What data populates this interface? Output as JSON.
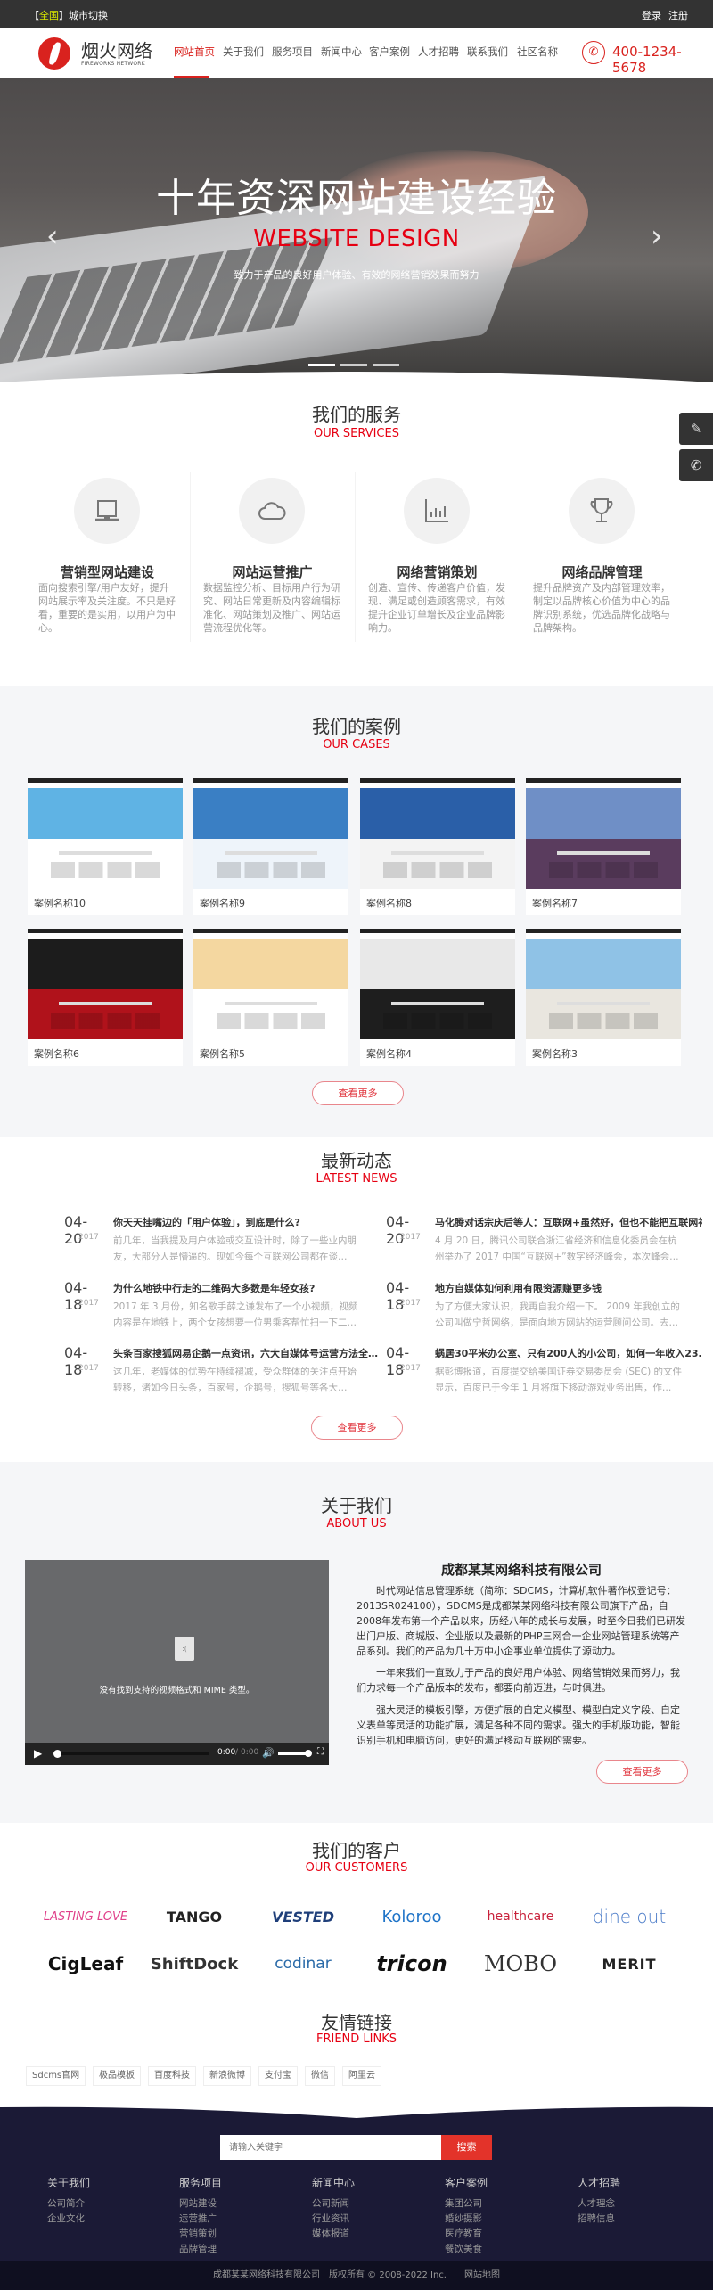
{
  "topbar": {
    "city_bracket_open": "【",
    "city_highlight": "全国",
    "city_bracket_close": "】",
    "city_switch": "城市切换",
    "login": "登录",
    "register": "注册"
  },
  "header": {
    "logo_name": "烟火网络",
    "logo_en": "FIREWORKS NETWORK",
    "phone": "400-1234-5678",
    "nav": [
      "网站首页",
      "关于我们",
      "服务项目",
      "新闻中心",
      "客户案例",
      "人才招聘",
      "联系我们",
      "社区名称"
    ],
    "active_index": 0
  },
  "hero": {
    "title": "十年资深网站建设经验",
    "subtitle_en": "WEBSITE DESIGN",
    "desc": "致力于产品的良好用户体验、有效的网络营销效果而努力",
    "slides": 3,
    "active_slide": 0
  },
  "services": {
    "title": "我们的服务",
    "title_en": "OUR SERVICES",
    "items": [
      {
        "icon": "laptop-icon",
        "title": "营销型网站建设",
        "desc": "面向搜索引擎/用户友好，提升网站展示率及关注度。不只是好看，重要的是实用，以用户为中心。"
      },
      {
        "icon": "cloud-icon",
        "title": "网站运营推广",
        "desc": "数据监控分析、目标用户行为研究、网站日常更新及内容编辑标准化、网站策划及推广、网站运营流程优化等。"
      },
      {
        "icon": "bar-chart-icon",
        "title": "网络营销策划",
        "desc": "创造、宣传、传递客户价值，发现、满足或创造顾客需求，有效提升企业订单增长及企业品牌影响力。"
      },
      {
        "icon": "trophy-icon",
        "title": "网络品牌管理",
        "desc": "提升品牌资产及内部管理效率，制定以品牌核心价值为中心的品牌识别系统，优选品牌化战略与品牌架构。"
      }
    ]
  },
  "cases": {
    "title": "我们的案例",
    "title_en": "OUR CASES",
    "more": "查看更多",
    "items": [
      {
        "name": "案例名称10",
        "colors": [
          "#5fb3e4",
          "#ffffff"
        ]
      },
      {
        "name": "案例名称9",
        "colors": [
          "#3a7fc4",
          "#eef4fa"
        ]
      },
      {
        "name": "案例名称8",
        "colors": [
          "#2a5fa8",
          "#f3f3f3"
        ]
      },
      {
        "name": "案例名称7",
        "colors": [
          "#6f8fc6",
          "#5a3c5e"
        ]
      },
      {
        "name": "案例名称6",
        "colors": [
          "#1c1c1c",
          "#b0121b"
        ]
      },
      {
        "name": "案例名称5",
        "colors": [
          "#f4d7a0",
          "#ffffff"
        ]
      },
      {
        "name": "案例名称4",
        "colors": [
          "#e8e8e8",
          "#1e1e1e"
        ]
      },
      {
        "name": "案例名称3",
        "colors": [
          "#8fc2e6",
          "#e9e6df"
        ]
      }
    ]
  },
  "news": {
    "title": "最新动态",
    "title_en": "LATEST NEWS",
    "more": "查看更多",
    "items": [
      {
        "date": "04-20",
        "year": "2017",
        "title": "你天天挂嘴边的「用户体验」，到底是什么?",
        "excerpt": "前几年，当我提及用户体验或交互设计时，除了一些业内朋友，大部分人是懵逼的。现如今每个互联网公司都在谈…"
      },
      {
        "date": "04-20",
        "year": "2017",
        "title": "马化腾对话宗庆后等人：互联网+虽然好，但也不能把互联网神",
        "excerpt": "4 月 20 日，腾讯公司联合浙江省经济和信息化委员会在杭州举办了 2017 中国“互联网+”数字经济峰会，本次峰会…"
      },
      {
        "date": "04-18",
        "year": "2017",
        "title": "为什么地铁中行走的二维码大多数是年轻女孩?",
        "excerpt": "2017 年 3 月份，知名歌手薛之谦发布了一个小视频，视频内容是在地铁上，两个女孩想要一位男乘客帮忙扫一下二…"
      },
      {
        "date": "04-18",
        "year": "2017",
        "title": "地方自媒体如何利用有限资源赚更多钱",
        "excerpt": "为了方便大家认识，我再自我介绍一下。 2009 年我创立的公司叫做宁哲网络，是面向地方网站的运营顾问公司。去…"
      },
      {
        "date": "04-18",
        "year": "2017",
        "title": "头条百家搜狐网易企鹅一点资讯，六大自媒体号运营方法全…",
        "excerpt": "这几年，老媒体的优势在持续褪减，受众群体的关注点开始转移，诸如今日头条，百家号，企鹅号，搜狐号等各大…"
      },
      {
        "date": "04-18",
        "year": "2017",
        "title": "蜗居30平米办公室、只有200人的小公司，如何一年收入23…",
        "excerpt": "据彭博报道，百度提交给美国证券交易委员会 (SEC) 的文件显示，百度已于今年 1 月将旗下移动游戏业务出售，作…"
      }
    ]
  },
  "about": {
    "title": "关于我们",
    "title_en": "ABOUT US",
    "company": "成都某某网络科技有限公司",
    "more": "查看更多",
    "video_error": "没有找到支持的视频格式和 MIME 类型。",
    "video_time": "0:00",
    "video_duration": "0:00",
    "paragraphs": [
      "时代网站信息管理系统（简称：SDCMS，计算机软件著作权登记号：2013SR024100），SDCMS是成都某某网络科技有限公司旗下产品，自2008年发布第一个产品以来，历经八年的成长与发展，时至今日我们已研发出门户版、商城版、企业版以及最新的PHP三网合一企业网站管理系统等产品系列。我们的产品为几十万中小企事业单位提供了源动力。",
      "十年来我们一直致力于产品的良好用户体验、网络营销效果而努力，我们力求每一个产品版本的发布，都要向前迈进，与时俱进。",
      "强大灵活的模板引擎，方便扩展的自定义模型、模型自定义字段、自定义表单等灵活的功能扩展，满足各种不同的需求。强大的手机版功能，智能识别手机和电脑访问，更好的满足移动互联网的需要。"
    ]
  },
  "customers": {
    "title": "我们的客户",
    "title_en": "OUR CUSTOMERS",
    "logos": [
      {
        "name": "LASTING LOVE",
        "color": "#e0408a"
      },
      {
        "name": "TANGO",
        "color": "#222222"
      },
      {
        "name": "VESTED",
        "color": "#1f3f7a"
      },
      {
        "name": "Koloroo",
        "color": "#1f74c8"
      },
      {
        "name": "healthcare",
        "color": "#c8203a"
      },
      {
        "name": "dine out",
        "color": "#4a7bc8"
      },
      {
        "name": "CigLeaf",
        "color": "#111111"
      },
      {
        "name": "ShiftDock",
        "color": "#333333"
      },
      {
        "name": "codinar",
        "color": "#2a6aa8"
      },
      {
        "name": "tricon",
        "color": "#111111"
      },
      {
        "name": "MOBO",
        "color": "#333333"
      },
      {
        "name": "MERIT",
        "color": "#222222"
      }
    ]
  },
  "friend_links": {
    "title": "友情链接",
    "title_en": "FRIEND LINKS",
    "items": [
      "Sdcms官网",
      "极品模板",
      "百度科技",
      "新浪微博",
      "支付宝",
      "微信",
      "阿里云"
    ]
  },
  "footer": {
    "search_placeholder": "请输入关键字",
    "search_button": "搜索",
    "columns": [
      {
        "title": "关于我们",
        "links": [
          "公司简介",
          "企业文化"
        ]
      },
      {
        "title": "服务项目",
        "links": [
          "网站建设",
          "运营推广",
          "营销策划",
          "品牌管理"
        ]
      },
      {
        "title": "新闻中心",
        "links": [
          "公司新闻",
          "行业资讯",
          "媒体报道"
        ]
      },
      {
        "title": "客户案例",
        "links": [
          "集团公司",
          "婚纱摄影",
          "医疗教育",
          "餐饮美食"
        ]
      },
      {
        "title": "人才招聘",
        "links": [
          "人才理念",
          "招聘信息"
        ]
      }
    ],
    "copyright": "成都某某网络科技有限公司　版权所有 © 2008-2022 Inc.",
    "sitemap": "网站地图"
  },
  "side_buttons": [
    "edit-icon",
    "phone-icon"
  ],
  "colors": {
    "accent": "#e60012",
    "topbar": "#333333",
    "footer": "#1b1a36"
  }
}
